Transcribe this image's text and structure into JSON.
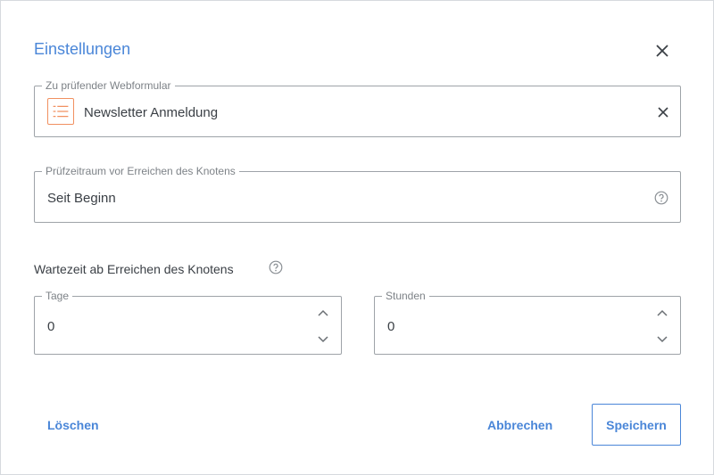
{
  "dialog": {
    "title": "Einstellungen"
  },
  "webform_field": {
    "legend": "Zu prüfender Webformular",
    "value": "Newsletter Anmeldung"
  },
  "period_field": {
    "legend": "Prüfzeitraum vor Erreichen des Knotens",
    "value": "Seit Beginn"
  },
  "wait_section": {
    "label": "Wartezeit ab Erreichen des Knotens"
  },
  "days_field": {
    "legend": "Tage",
    "value": "0"
  },
  "hours_field": {
    "legend": "Stunden",
    "value": "0"
  },
  "footer": {
    "delete_label": "Löschen",
    "cancel_label": "Abbrechen",
    "save_label": "Speichern"
  },
  "colors": {
    "accent": "#4a86d8",
    "form_icon": "#f19060",
    "border": "#9ea3a8"
  },
  "icons": [
    "close-icon",
    "form-list-icon",
    "clear-icon",
    "help-icon",
    "chevron-up-icon",
    "chevron-down-icon"
  ]
}
